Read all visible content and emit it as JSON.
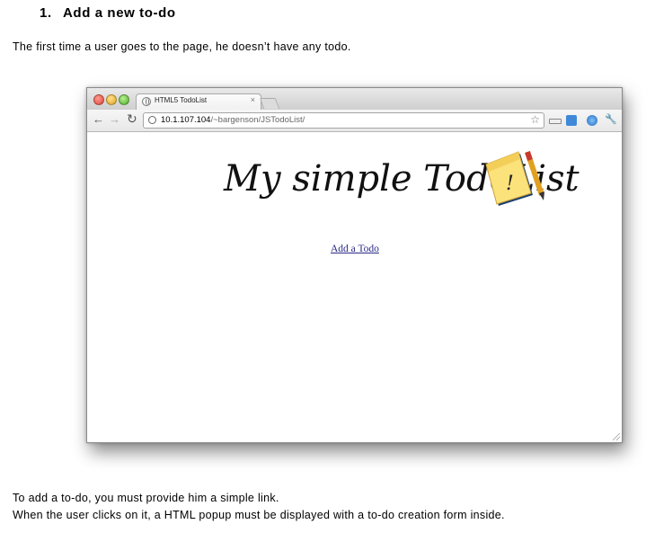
{
  "heading": {
    "number": "1.",
    "text": "Add a new to-do"
  },
  "intro": "The first time a user goes to the page, he doesn’t have any todo.",
  "browser": {
    "tab_title": "HTML5 TodoList",
    "tab_close": "×",
    "url_host": "10.1.107.104",
    "url_path": "/~bargenson/JSTodoList/",
    "nav": {
      "back": "←",
      "forward": "→",
      "reload": "↻"
    },
    "star": "☆",
    "extensions": [
      "page-icon",
      "puzzle-icon",
      "globe-icon",
      "wrench-icon"
    ]
  },
  "app": {
    "logo_text": "My simple TodoList",
    "logo_note_mark": "!",
    "add_link": "Add a Todo"
  },
  "outro": {
    "line1": "To add a to-do, you must provide him a simple link.",
    "line2": "When the user clicks on it, a HTML popup must be displayed with a to-do creation form inside."
  }
}
